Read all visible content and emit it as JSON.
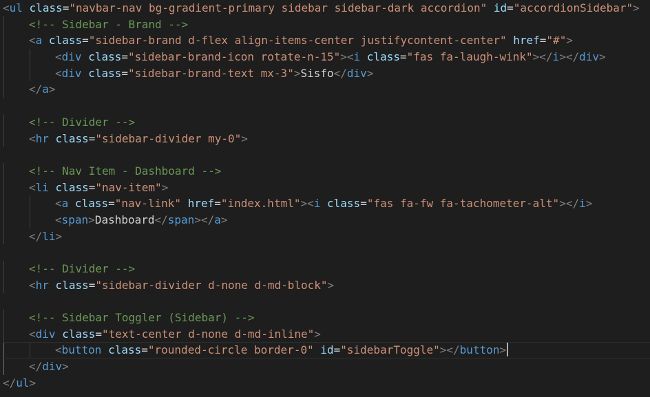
{
  "editor": {
    "lines": [
      {
        "indent": 0,
        "tokens": [
          {
            "t": "punc",
            "v": "<"
          },
          {
            "t": "tag",
            "v": "ul"
          },
          {
            "t": "text",
            "v": " "
          },
          {
            "t": "attr",
            "v": "class"
          },
          {
            "t": "text",
            "v": "="
          },
          {
            "t": "str",
            "v": "\"navbar-nav bg-gradient-primary sidebar sidebar-dark accordion\""
          },
          {
            "t": "text",
            "v": " "
          },
          {
            "t": "attr",
            "v": "id"
          },
          {
            "t": "text",
            "v": "="
          },
          {
            "t": "str",
            "v": "\"accordionSidebar\""
          },
          {
            "t": "punc",
            "v": ">"
          }
        ]
      },
      {
        "indent": 1,
        "tokens": [
          {
            "t": "com",
            "v": "<!-- Sidebar - Brand -->"
          }
        ]
      },
      {
        "indent": 1,
        "tokens": [
          {
            "t": "punc",
            "v": "<"
          },
          {
            "t": "tag",
            "v": "a"
          },
          {
            "t": "text",
            "v": " "
          },
          {
            "t": "attr",
            "v": "class"
          },
          {
            "t": "text",
            "v": "="
          },
          {
            "t": "str",
            "v": "\"sidebar-brand d-flex align-items-center justifycontent-center\""
          },
          {
            "t": "text",
            "v": " "
          },
          {
            "t": "attr",
            "v": "href"
          },
          {
            "t": "text",
            "v": "="
          },
          {
            "t": "str",
            "v": "\"#\""
          },
          {
            "t": "punc",
            "v": ">"
          }
        ]
      },
      {
        "indent": 2,
        "tokens": [
          {
            "t": "punc",
            "v": "<"
          },
          {
            "t": "tag",
            "v": "div"
          },
          {
            "t": "text",
            "v": " "
          },
          {
            "t": "attr",
            "v": "class"
          },
          {
            "t": "text",
            "v": "="
          },
          {
            "t": "str",
            "v": "\"sidebar-brand-icon rotate-n-15\""
          },
          {
            "t": "punc",
            "v": "><"
          },
          {
            "t": "tag",
            "v": "i"
          },
          {
            "t": "text",
            "v": " "
          },
          {
            "t": "attr",
            "v": "class"
          },
          {
            "t": "text",
            "v": "="
          },
          {
            "t": "str",
            "v": "\"fas fa-laugh-wink\""
          },
          {
            "t": "punc",
            "v": "></"
          },
          {
            "t": "tag",
            "v": "i"
          },
          {
            "t": "punc",
            "v": "></"
          },
          {
            "t": "tag",
            "v": "div"
          },
          {
            "t": "punc",
            "v": ">"
          }
        ]
      },
      {
        "indent": 2,
        "tokens": [
          {
            "t": "punc",
            "v": "<"
          },
          {
            "t": "tag",
            "v": "div"
          },
          {
            "t": "text",
            "v": " "
          },
          {
            "t": "attr",
            "v": "class"
          },
          {
            "t": "text",
            "v": "="
          },
          {
            "t": "str",
            "v": "\"sidebar-brand-text mx-3\""
          },
          {
            "t": "punc",
            "v": ">"
          },
          {
            "t": "text",
            "v": "Sisfo"
          },
          {
            "t": "punc",
            "v": "</"
          },
          {
            "t": "tag",
            "v": "div"
          },
          {
            "t": "punc",
            "v": ">"
          }
        ]
      },
      {
        "indent": 1,
        "tokens": [
          {
            "t": "punc",
            "v": "</"
          },
          {
            "t": "tag",
            "v": "a"
          },
          {
            "t": "punc",
            "v": ">"
          }
        ]
      },
      {
        "indent": 0,
        "tokens": []
      },
      {
        "indent": 1,
        "tokens": [
          {
            "t": "com",
            "v": "<!-- Divider -->"
          }
        ]
      },
      {
        "indent": 1,
        "tokens": [
          {
            "t": "punc",
            "v": "<"
          },
          {
            "t": "tag",
            "v": "hr"
          },
          {
            "t": "text",
            "v": " "
          },
          {
            "t": "attr",
            "v": "class"
          },
          {
            "t": "text",
            "v": "="
          },
          {
            "t": "str",
            "v": "\"sidebar-divider my-0\""
          },
          {
            "t": "punc",
            "v": ">"
          }
        ]
      },
      {
        "indent": 0,
        "tokens": []
      },
      {
        "indent": 1,
        "tokens": [
          {
            "t": "com",
            "v": "<!-- Nav Item - Dashboard -->"
          }
        ]
      },
      {
        "indent": 1,
        "tokens": [
          {
            "t": "punc",
            "v": "<"
          },
          {
            "t": "tag",
            "v": "li"
          },
          {
            "t": "text",
            "v": " "
          },
          {
            "t": "attr",
            "v": "class"
          },
          {
            "t": "text",
            "v": "="
          },
          {
            "t": "str",
            "v": "\"nav-item\""
          },
          {
            "t": "punc",
            "v": ">"
          }
        ]
      },
      {
        "indent": 2,
        "tokens": [
          {
            "t": "punc",
            "v": "<"
          },
          {
            "t": "tag",
            "v": "a"
          },
          {
            "t": "text",
            "v": " "
          },
          {
            "t": "attr",
            "v": "class"
          },
          {
            "t": "text",
            "v": "="
          },
          {
            "t": "str",
            "v": "\"nav-link\""
          },
          {
            "t": "text",
            "v": " "
          },
          {
            "t": "attr",
            "v": "href"
          },
          {
            "t": "text",
            "v": "="
          },
          {
            "t": "str",
            "v": "\"index.html\""
          },
          {
            "t": "punc",
            "v": "><"
          },
          {
            "t": "tag",
            "v": "i"
          },
          {
            "t": "text",
            "v": " "
          },
          {
            "t": "attr",
            "v": "class"
          },
          {
            "t": "text",
            "v": "="
          },
          {
            "t": "str",
            "v": "\"fas fa-fw fa-tachometer-alt\""
          },
          {
            "t": "punc",
            "v": "></"
          },
          {
            "t": "tag",
            "v": "i"
          },
          {
            "t": "punc",
            "v": ">"
          }
        ]
      },
      {
        "indent": 2,
        "tokens": [
          {
            "t": "punc",
            "v": "<"
          },
          {
            "t": "tag",
            "v": "span"
          },
          {
            "t": "punc",
            "v": ">"
          },
          {
            "t": "text",
            "v": "Dashboard"
          },
          {
            "t": "punc",
            "v": "</"
          },
          {
            "t": "tag",
            "v": "span"
          },
          {
            "t": "punc",
            "v": "></"
          },
          {
            "t": "tag",
            "v": "a"
          },
          {
            "t": "punc",
            "v": ">"
          }
        ]
      },
      {
        "indent": 1,
        "tokens": [
          {
            "t": "punc",
            "v": "</"
          },
          {
            "t": "tag",
            "v": "li"
          },
          {
            "t": "punc",
            "v": ">"
          }
        ]
      },
      {
        "indent": 0,
        "tokens": []
      },
      {
        "indent": 1,
        "tokens": [
          {
            "t": "com",
            "v": "<!-- Divider -->"
          }
        ]
      },
      {
        "indent": 1,
        "tokens": [
          {
            "t": "punc",
            "v": "<"
          },
          {
            "t": "tag",
            "v": "hr"
          },
          {
            "t": "text",
            "v": " "
          },
          {
            "t": "attr",
            "v": "class"
          },
          {
            "t": "text",
            "v": "="
          },
          {
            "t": "str",
            "v": "\"sidebar-divider d-none d-md-block\""
          },
          {
            "t": "punc",
            "v": ">"
          }
        ]
      },
      {
        "indent": 0,
        "tokens": []
      },
      {
        "indent": 1,
        "tokens": [
          {
            "t": "com",
            "v": "<!-- Sidebar Toggler (Sidebar) -->"
          }
        ]
      },
      {
        "indent": 1,
        "tokens": [
          {
            "t": "punc",
            "v": "<"
          },
          {
            "t": "tag",
            "v": "div"
          },
          {
            "t": "text",
            "v": " "
          },
          {
            "t": "attr",
            "v": "class"
          },
          {
            "t": "text",
            "v": "="
          },
          {
            "t": "str",
            "v": "\"text-center d-none d-md-inline\""
          },
          {
            "t": "punc",
            "v": ">"
          }
        ]
      },
      {
        "indent": 2,
        "current": true,
        "caret": true,
        "tokens": [
          {
            "t": "punc",
            "v": "<"
          },
          {
            "t": "tag",
            "v": "button"
          },
          {
            "t": "text",
            "v": " "
          },
          {
            "t": "attr",
            "v": "class"
          },
          {
            "t": "text",
            "v": "="
          },
          {
            "t": "str",
            "v": "\"rounded-circle border-0\""
          },
          {
            "t": "text",
            "v": " "
          },
          {
            "t": "attr",
            "v": "id"
          },
          {
            "t": "text",
            "v": "="
          },
          {
            "t": "str",
            "v": "\"sidebarToggle\""
          },
          {
            "t": "punc",
            "v": "></"
          },
          {
            "t": "tag",
            "v": "button"
          },
          {
            "t": "punc",
            "v": ">"
          }
        ]
      },
      {
        "indent": 1,
        "tokens": [
          {
            "t": "punc",
            "v": "</"
          },
          {
            "t": "tag",
            "v": "div"
          },
          {
            "t": "punc",
            "v": ">"
          }
        ]
      },
      {
        "indent": 0,
        "tokens": [
          {
            "t": "punc",
            "v": "</"
          },
          {
            "t": "tag",
            "v": "ul"
          },
          {
            "t": "punc",
            "v": ">"
          }
        ]
      }
    ]
  },
  "colors": {
    "background": "#1e1e1e",
    "punctuation": "#808080",
    "tag": "#569cd6",
    "attribute": "#9cdcfe",
    "string": "#ce9178",
    "comment": "#6a9955",
    "text": "#d4d4d4"
  }
}
